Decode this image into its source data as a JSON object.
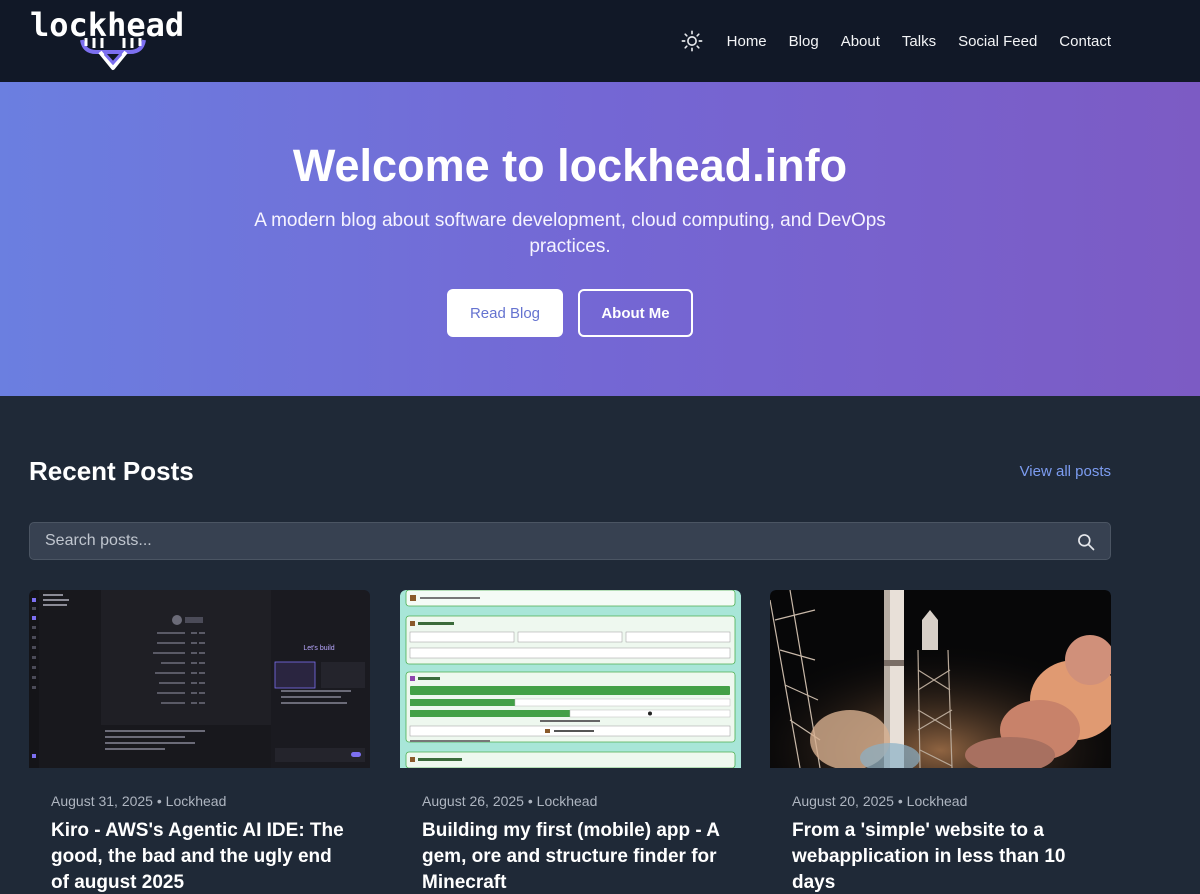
{
  "header": {
    "logo_text": "lockhead",
    "nav": [
      {
        "label": "Home"
      },
      {
        "label": "Blog"
      },
      {
        "label": "About"
      },
      {
        "label": "Talks"
      },
      {
        "label": "Social Feed"
      },
      {
        "label": "Contact"
      }
    ],
    "theme_icon": "sun-icon"
  },
  "hero": {
    "title": "Welcome to lockhead.info",
    "subtitle": "A modern blog about software development, cloud computing, and DevOps practices.",
    "primary_button": "Read Blog",
    "secondary_button": "About Me",
    "gradient_start": "#6b7fe0",
    "gradient_end": "#7c5bc4"
  },
  "recent": {
    "title": "Recent Posts",
    "view_all": "View all posts",
    "search_placeholder": "Search posts...",
    "posts": [
      {
        "date": "August 31, 2025",
        "author": "Lockhead",
        "meta": "August 31, 2025 • Lockhead",
        "title": "Kiro - AWS's Agentic AI IDE: The good, the bad and the ugly end of august 2025",
        "image": "ide-screenshot"
      },
      {
        "date": "August 26, 2025",
        "author": "Lockhead",
        "meta": "August 26, 2025 • Lockhead",
        "title": "Building my first (mobile) app - A gem, ore and structure finder for Minecraft",
        "image": "app-screenshot"
      },
      {
        "date": "August 20, 2025",
        "author": "Lockhead",
        "meta": "August 20, 2025 • Lockhead",
        "title": "From a 'simple' website to a webapplication in less than 10 days",
        "image": "rocket-launch-photo"
      }
    ]
  },
  "colors": {
    "header_bg": "#111827",
    "page_bg": "#1f2937",
    "link_accent": "#7c9cf0",
    "logo_accent": "#7c6ff0"
  }
}
